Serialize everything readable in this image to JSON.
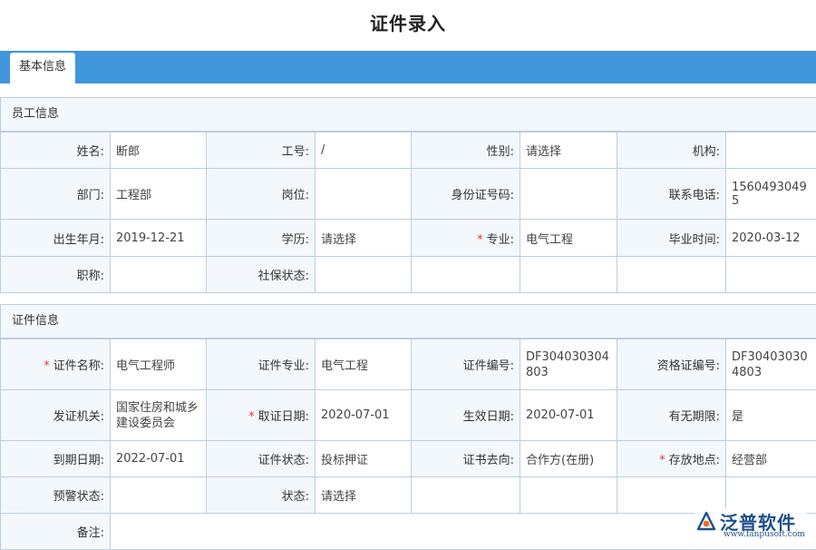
{
  "page": {
    "title": "证件录入"
  },
  "tabs": [
    {
      "label": "基本信息"
    }
  ],
  "employee": {
    "section_title": "员工信息",
    "rows": [
      [
        {
          "label": "姓名:",
          "value": "断郎",
          "required": false
        },
        {
          "label": "工号:",
          "value": "/",
          "required": false
        },
        {
          "label": "性别:",
          "value": "请选择",
          "required": false
        },
        {
          "label": "机构:",
          "value": "",
          "required": false
        }
      ],
      [
        {
          "label": "部门:",
          "value": "工程部",
          "required": false
        },
        {
          "label": "岗位:",
          "value": "",
          "required": false
        },
        {
          "label": "身份证号码:",
          "value": "",
          "required": false
        },
        {
          "label": "联系电话:",
          "value": "15604930495",
          "required": false
        }
      ],
      [
        {
          "label": "出生年月:",
          "value": "2019-12-21",
          "required": false
        },
        {
          "label": "学历:",
          "value": "请选择",
          "required": false
        },
        {
          "label": "专业:",
          "value": "电气工程",
          "required": true
        },
        {
          "label": "毕业时间:",
          "value": "2020-03-12",
          "required": false
        }
      ],
      [
        {
          "label": "职称:",
          "value": "",
          "required": false
        },
        {
          "label": "社保状态:",
          "value": "",
          "required": false
        },
        {
          "label": "",
          "value": "",
          "required": false
        },
        {
          "label": "",
          "value": "",
          "required": false
        }
      ]
    ]
  },
  "certificate": {
    "section_title": "证件信息",
    "rows": [
      [
        {
          "label": "证件名称:",
          "value": "电气工程师",
          "required": true
        },
        {
          "label": "证件专业:",
          "value": "电气工程",
          "required": false
        },
        {
          "label": "证件编号:",
          "value": "DF304030304803",
          "required": false
        },
        {
          "label": "资格证编号:",
          "value": "DF304030304803",
          "required": false
        }
      ],
      [
        {
          "label": "发证机关:",
          "value": "国家住房和城乡建设委员会",
          "required": false
        },
        {
          "label": "取证日期:",
          "value": "2020-07-01",
          "required": true
        },
        {
          "label": "生效日期:",
          "value": "2020-07-01",
          "required": false
        },
        {
          "label": "有无期限:",
          "value": "是",
          "required": false
        }
      ],
      [
        {
          "label": "到期日期:",
          "value": "2022-07-01",
          "required": false
        },
        {
          "label": "证件状态:",
          "value": "投标押证",
          "required": false
        },
        {
          "label": "证书去向:",
          "value": "合作方(在册)",
          "required": false
        },
        {
          "label": "存放地点:",
          "value": "经营部",
          "required": true
        }
      ],
      [
        {
          "label": "预警状态:",
          "value": "",
          "required": false
        },
        {
          "label": "状态:",
          "value": "请选择",
          "required": false
        },
        {
          "label": "",
          "value": "",
          "required": false
        },
        {
          "label": "",
          "value": "",
          "required": false
        }
      ],
      [
        {
          "label": "备注:",
          "value": "",
          "required": false
        }
      ]
    ]
  },
  "watermark": {
    "brand": "泛普软件",
    "url": "www.fanpusoft.com",
    "color": "#1d4f8c"
  },
  "colors": {
    "tab_bar": "#3f96db",
    "label_bg": "#f3f8fd",
    "border": "#b9cfe0",
    "required": "#ee3333"
  }
}
